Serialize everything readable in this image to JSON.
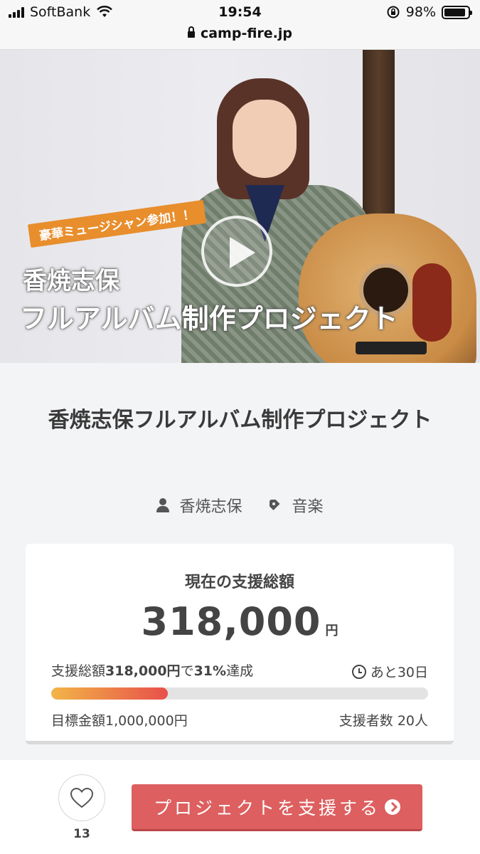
{
  "status_bar": {
    "carrier": "SoftBank",
    "time": "19:54",
    "battery": "98%",
    "url": "camp-fire.jp"
  },
  "hero": {
    "badge": "豪華ミュージシャン参加！！",
    "line1": "香焼志保",
    "line2": "フルアルバム制作プロジェクト"
  },
  "project": {
    "title": "香焼志保フルアルバム制作プロジェクト",
    "owner": "香焼志保",
    "category": "音楽"
  },
  "funding": {
    "label": "現在の支援総額",
    "amount": "318,000",
    "currency": "円",
    "achievement_prefix": "支援総額",
    "achievement_amount": "318,000円",
    "achievement_mid": "で",
    "achievement_percent": "31%",
    "achievement_suffix": "達成",
    "progress_percent": 31,
    "days_left": "あと30日",
    "goal": "目標金額1,000,000円",
    "backers": "支援者数 20人"
  },
  "actions": {
    "like_count": "13",
    "support_button": "プロジェクトを支援する"
  }
}
